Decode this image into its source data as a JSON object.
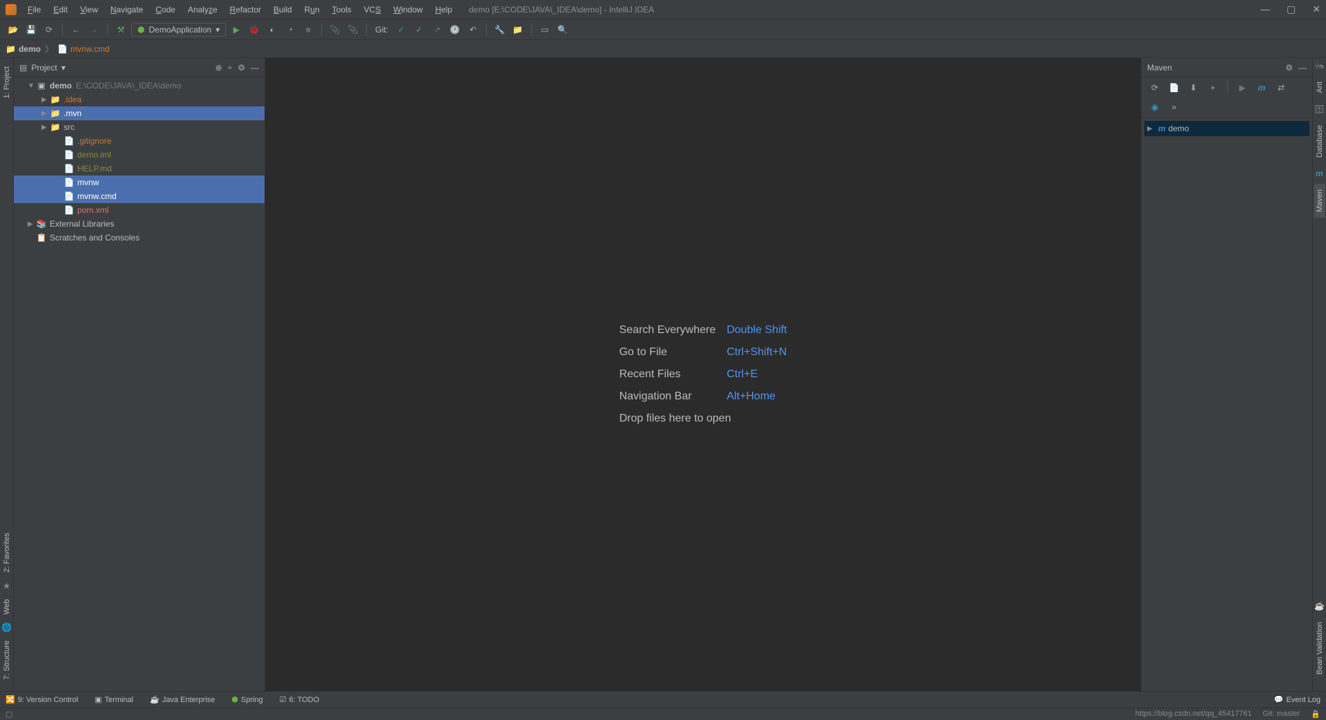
{
  "title": "demo [E:\\CODE\\JAVA\\_IDEA\\demo] - IntelliJ IDEA",
  "menu": [
    "File",
    "Edit",
    "View",
    "Navigate",
    "Code",
    "Analyze",
    "Refactor",
    "Build",
    "Run",
    "Tools",
    "VCS",
    "Window",
    "Help"
  ],
  "run_config": "DemoApplication",
  "git_label": "Git:",
  "breadcrumb": {
    "folder": "demo",
    "file": "mvnw.cmd"
  },
  "project": {
    "title": "Project",
    "root": {
      "name": "demo",
      "path": "E:\\CODE\\JAVA\\_IDEA\\demo"
    },
    "items": [
      {
        "name": ".idea",
        "kind": "folder",
        "color": "orange",
        "arrow": "collapsed",
        "indent": 2,
        "selected": false
      },
      {
        "name": ".mvn",
        "kind": "folder",
        "color": "normal",
        "arrow": "collapsed",
        "indent": 2,
        "selected": true
      },
      {
        "name": "src",
        "kind": "folder",
        "color": "normal",
        "arrow": "collapsed",
        "indent": 2,
        "selected": false
      },
      {
        "name": ".gitignore",
        "kind": "file",
        "color": "orange",
        "arrow": "",
        "indent": 3,
        "selected": false
      },
      {
        "name": "demo.iml",
        "kind": "file",
        "color": "olive",
        "arrow": "",
        "indent": 3,
        "selected": false
      },
      {
        "name": "HELP.md",
        "kind": "file",
        "color": "olive",
        "arrow": "",
        "indent": 3,
        "selected": false
      },
      {
        "name": "mvnw",
        "kind": "file",
        "color": "normal",
        "arrow": "",
        "indent": 3,
        "selected": true
      },
      {
        "name": "mvnw.cmd",
        "kind": "file",
        "color": "normal",
        "arrow": "",
        "indent": 3,
        "selected": true
      },
      {
        "name": "pom.xml",
        "kind": "file",
        "color": "red",
        "arrow": "",
        "indent": 3,
        "selected": false
      }
    ],
    "external": "External Libraries",
    "scratches": "Scratches and Consoles"
  },
  "welcome": {
    "search": "Search Everywhere",
    "search_key": "Double Shift",
    "goto": "Go to File",
    "goto_key": "Ctrl+Shift+N",
    "recent": "Recent Files",
    "recent_key": "Ctrl+E",
    "nav": "Navigation Bar",
    "nav_key": "Alt+Home",
    "drop": "Drop files here to open"
  },
  "maven": {
    "title": "Maven",
    "project": "demo"
  },
  "right_tabs": [
    "Ant",
    "Database",
    "Maven",
    "Bean Validation"
  ],
  "left_tabs_upper": [
    "1: Project"
  ],
  "left_tabs_lower": [
    "2: Favorites",
    "Web",
    "7: Structure"
  ],
  "bottom": {
    "version_control": "9: Version Control",
    "terminal": "Terminal",
    "java_ee": "Java Enterprise",
    "spring": "Spring",
    "todo": "6: TODO",
    "event_log": "Event Log"
  },
  "status": {
    "url": "https://blog.csdn.net/qq_45417761",
    "git": "Git: master"
  }
}
